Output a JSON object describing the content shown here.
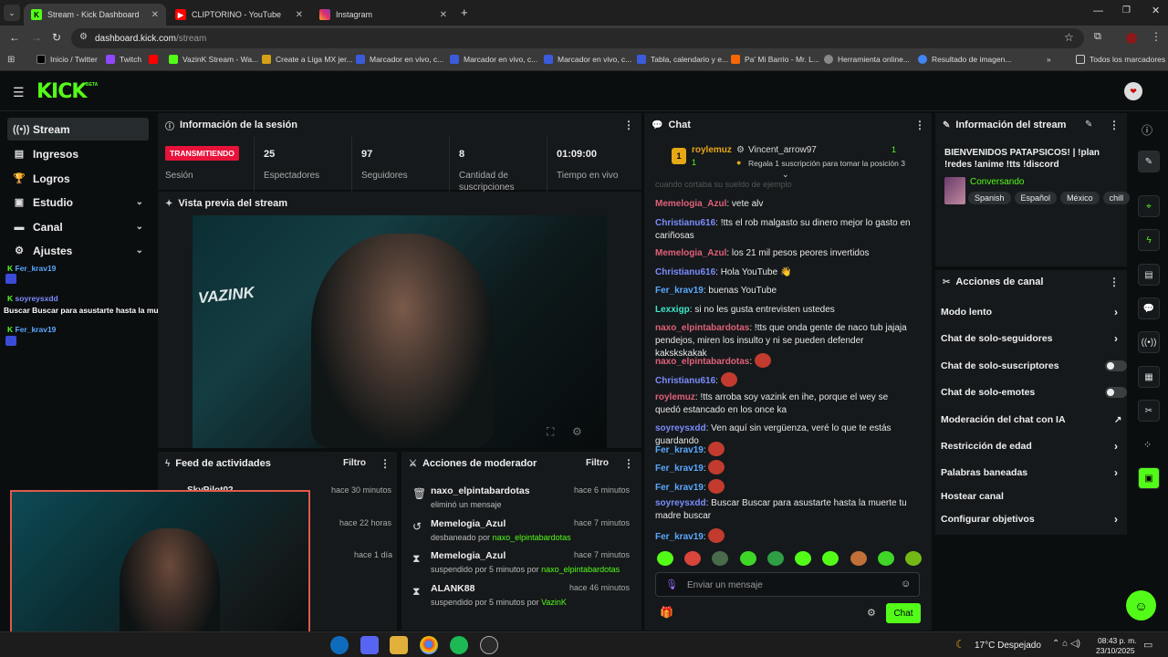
{
  "browser": {
    "tabs": [
      {
        "title": "Stream - Kick Dashboard"
      },
      {
        "title": "CLIPTORINO - YouTube"
      },
      {
        "title": "Instagram"
      }
    ],
    "url_host": "dashboard.kick.com",
    "url_path": "/stream",
    "bookmarks": [
      "Inicio / Twitter",
      "Twitch",
      "VazinK Stream - Wa...",
      "Create a Liga MX jer...",
      "Marcador en vivo, c...",
      "Marcador en vivo, c...",
      "Marcador en vivo, c...",
      "Tabla, calendario y e...",
      "Pa' Mi Barrio - Mr. L...",
      "Herramienta online...",
      "Resultado de imagen..."
    ],
    "all_bookmarks": "Todos los marcadores"
  },
  "kick": {
    "logo": "KICK",
    "beta": "BETA"
  },
  "sidebar": {
    "items": [
      {
        "label": "Stream",
        "icon": "stream-icon"
      },
      {
        "label": "Ingresos",
        "icon": "money-icon"
      },
      {
        "label": "Logros",
        "icon": "trophy-icon"
      },
      {
        "label": "Estudio",
        "icon": "studio-icon"
      },
      {
        "label": "Canal",
        "icon": "channel-icon"
      },
      {
        "label": "Ajustes",
        "icon": "gear-icon"
      }
    ],
    "overlay": [
      {
        "user": "Fer_krav19"
      },
      {
        "user": "soyreysxdd"
      },
      {
        "text": "Buscar Buscar para asustarte hasta la muerte tu madre buscar"
      },
      {
        "user": "Fer_krav19"
      }
    ]
  },
  "session": {
    "title": "Información de la sesión",
    "status": "TRANSMITIENDO",
    "status_label": "Sesión",
    "stats": [
      {
        "value": "25",
        "label": "Espectadores"
      },
      {
        "value": "97",
        "label": "Seguidores"
      },
      {
        "value": "8",
        "label": "Cantidad de suscripciones"
      },
      {
        "value": "01:09:00",
        "label": "Tiempo en vivo"
      }
    ]
  },
  "preview": {
    "title": "Vista previa del stream",
    "overlay_text": "VAZINK"
  },
  "feed": {
    "title": "Feed de actividades",
    "filter": "Filtro",
    "items": [
      {
        "name": "SkyPilot02",
        "time": "hace 30 minutos"
      },
      {
        "name": "",
        "time": "hace 22 horas"
      },
      {
        "name": "",
        "time": "hace 1 día"
      }
    ]
  },
  "mod": {
    "title": "Acciones de moderador",
    "filter": "Filtro",
    "items": [
      {
        "name": "naxo_elpintabardotas",
        "desc": "eliminó un mensaje",
        "by": "",
        "time": "hace 6 minutos",
        "icon": "trash-icon"
      },
      {
        "name": "Memelogia_Azul",
        "desc": "desbaneado por ",
        "by": "naxo_elpintabardotas",
        "time": "hace 7 minutos",
        "icon": "unban-icon"
      },
      {
        "name": "Memelogia_Azul",
        "desc": "suspendido por 5 minutos por ",
        "by": "naxo_elpintabardotas",
        "time": "hace 7 minutos",
        "icon": "hourglass-icon"
      },
      {
        "name": "ALANK88",
        "desc": "suspendido por 5 minutos por ",
        "by": "VazinK",
        "time": "hace 46 minutos",
        "icon": "hourglass-icon"
      }
    ]
  },
  "chat": {
    "title": "Chat",
    "pinned": {
      "user": "roylemuz",
      "count": "1",
      "user2": "Vincent_arrow97",
      "count2": "1",
      "gift_text": "Regala 1 suscripción para tomar la posición 3"
    },
    "cut_text": "cuando cortaba su sueldo de ejemplo",
    "messages": [
      {
        "user": "Memelogia_Azul",
        "color": "#e0607a",
        "text": "vete alv"
      },
      {
        "user": "Christianu616",
        "color": "#7b8cff",
        "text": "!tts el rob malgasto su dinero mejor lo gasto en cariñosas"
      },
      {
        "user": "Memelogia_Azul",
        "color": "#e0607a",
        "text": "los 21 mil pesos peores invertidos"
      },
      {
        "user": "Christianu616",
        "color": "#7b8cff",
        "text": "Hola YouTube 👋"
      },
      {
        "user": "Fer_krav19",
        "color": "#5aa8ff",
        "text": "buenas YouTube"
      },
      {
        "user": "Lexxigp",
        "color": "#3ee6c8",
        "text": "si no les gusta entrevisten ustedes"
      },
      {
        "user": "naxo_elpintabardotas",
        "color": "#e0607a",
        "text": "!tts que onda gente de naco tub jajaja pendejos, miren los insulto y ni se pueden defender kakskskakak"
      },
      {
        "user": "naxo_elpintabardotas",
        "color": "#e0607a",
        "text": ""
      },
      {
        "user": "Christianu616",
        "color": "#7b8cff",
        "text": ""
      },
      {
        "user": "roylemuz",
        "color": "#e0607a",
        "text": "!tts arroba soy vazink en ihe, porque el wey se quedó estancado en los once ka"
      },
      {
        "user": "soyreysxdd",
        "color": "#7b8cff",
        "text": "Ven aquí sin vergüenza, veré lo que te estás guardando"
      },
      {
        "user": "Fer_krav19",
        "color": "#5aa8ff",
        "text": ""
      },
      {
        "user": "Fer_krav19",
        "color": "#5aa8ff",
        "text": ""
      },
      {
        "user": "Fer_krav19",
        "color": "#5aa8ff",
        "text": ""
      },
      {
        "user": "soyreysxdd",
        "color": "#7b8cff",
        "text": "Buscar Buscar para asustarte hasta la muerte tu madre buscar"
      },
      {
        "user": "Fer_krav19",
        "color": "#5aa8ff",
        "text": ""
      }
    ],
    "input_placeholder": "Enviar un mensaje",
    "send_label": "Chat"
  },
  "stream_info": {
    "title": "Información del stream",
    "stream_title": "BIENVENIDOS PATAPSICOS! | !plan !redes !anime !tts !discord",
    "category": "Conversando",
    "tags": [
      "Spanish",
      "Español",
      "México",
      "chill"
    ]
  },
  "channel_actions": {
    "title": "Acciones de canal",
    "items": [
      {
        "label": "Modo lento",
        "type": "arrow"
      },
      {
        "label": "Chat de solo-seguidores",
        "type": "arrow"
      },
      {
        "label": "Chat de solo-suscriptores",
        "type": "toggle"
      },
      {
        "label": "Chat de solo-emotes",
        "type": "toggle"
      },
      {
        "label": "Moderación del chat con IA",
        "type": "external"
      },
      {
        "label": "Restricción de edad",
        "type": "arrow"
      },
      {
        "label": "Palabras baneadas",
        "type": "arrow"
      },
      {
        "label": "Hostear canal",
        "type": "none"
      },
      {
        "label": "Configurar objetivos",
        "type": "arrow"
      }
    ]
  },
  "taskbar": {
    "weather": "17°C Despejado",
    "time": "08:43 p. m.",
    "date": "23/10/2025"
  },
  "colors": {
    "accent": "#53fc18",
    "live": "#e8133a",
    "panel": "#15191b",
    "bg": "#0b0e0f"
  }
}
